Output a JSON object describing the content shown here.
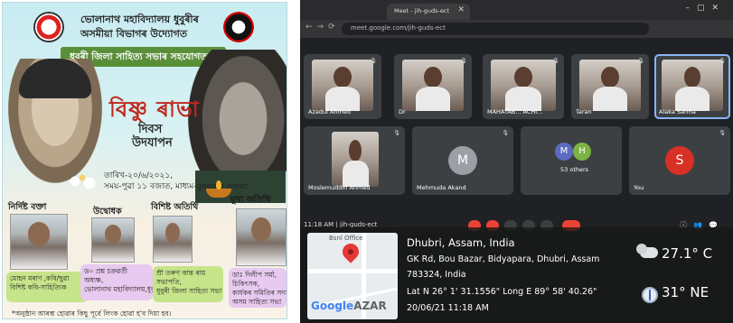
{
  "poster": {
    "college_line1": "ভোলানাথ মহাবিদ্যালয় ধুবুৰীৰ",
    "college_line2": "অসমীয়া বিভাগৰ উদ্যোগত",
    "banner": "ধুবুৰী জিলা সাহিত্য সভাৰ সহযোগত",
    "title": "বিষ্ণু ৰাভা",
    "subtitle1": "দিবস",
    "subtitle2": "উদযাপন",
    "date_line": "তাৰিখ-২০/৬/২০২১,",
    "time_line": "সময়-পুৱা ১১ বজাত, মাধ্যম-google meet",
    "labels": {
      "special_speaker": "নিৰ্দিষ্ট বক্তা",
      "inaugurator": "উদ্বোধক",
      "special_guest": "বিশিষ্ট অতিথি",
      "chief_guest": "মুখ্য অতিথি"
    },
    "cards": {
      "speaker": [
        "মোহন মৰাণ ,কবি/ছুৱা",
        "বিশিষ্ট কবি-সাহিত্যিক"
      ],
      "inaugurator": [
        "ড০ প্ৰশ্ন চক্ৰৱৰ্তী",
        "অধ্যক্ষ,",
        "ভোলানাথ মহাবিদ্যালয়,ধুবুৰী"
      ],
      "special_guest": [
        "শ্ৰী তৰুণ কান্ত ৰায়",
        "সভাপতি,",
        "ধুবুৰী জিলা সাহিত্য সভা"
      ],
      "chief_guest": [
        "ডাঃ দিলীপ সৰ্মা,",
        "চিকিৎসক,",
        "কাৰ্যকৰ সমিতিৰ সদস্য",
        "অসম সাহিত্য সভা"
      ]
    },
    "footer": "*অনুষ্ঠান আৰম্ভ হোৱাৰ কিছু পূৰ্বে লিংক হোৱা হ'ব দিয়া হব।"
  },
  "browser": {
    "tab_title": "Meet - jih-guds-ect",
    "url": "meet.google.com/jih-guds-ect"
  },
  "meet": {
    "tiles_top": [
      {
        "name": "Azadul Ahmed",
        "video": true,
        "active": false
      },
      {
        "name": "Dr",
        "video": true,
        "active": false
      },
      {
        "name": "MAHATAB... ACHI...",
        "video": true,
        "active": false
      },
      {
        "name": "Taran",
        "video": true,
        "active": false
      },
      {
        "name": "Alaka Sarma",
        "video": true,
        "active": true
      }
    ],
    "tiles_bottom": [
      {
        "name": "Moslemuddin Ahmed",
        "video": true
      },
      {
        "name": "Mehmuda Akand",
        "initial": "M",
        "color": "#9aa0a6"
      },
      {
        "name": "53 others",
        "initials": [
          "M",
          "H"
        ],
        "colors": [
          "#5c6bc0",
          "#7cb342"
        ]
      },
      {
        "name": "You",
        "initial": "S",
        "color": "#d93025"
      }
    ],
    "time_and_code": "11:18 AM  |  jih-guds-ect"
  },
  "geotag": {
    "map_label": "Bsnl Office",
    "brand": "Google",
    "brand_suffix": "AZAR",
    "city": "Dhubri, Assam, India",
    "address": "GK Rd, Bou Bazar, Bidyapara, Dhubri, Assam",
    "pincode": "783324, India",
    "coords": "Lat N 26° 1' 31.1556\" Long E 89° 58' 40.26\"",
    "timestamp": "20/06/21 11:18 AM",
    "temperature": "27.1° C",
    "wind": "31° NE"
  }
}
